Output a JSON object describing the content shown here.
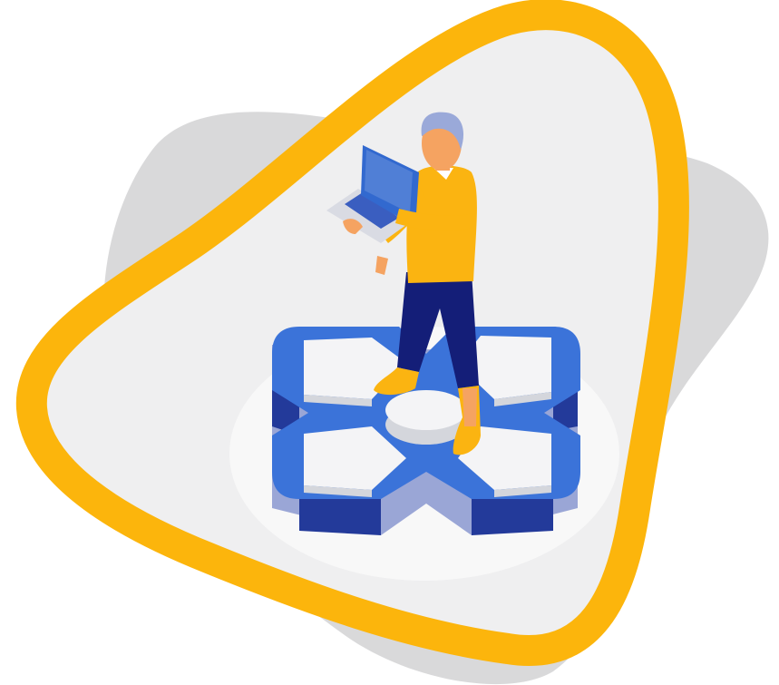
{
  "colors": {
    "background": "#ffffff",
    "gray_blob": "#d9d9da",
    "triangle_fill": "#efeff0",
    "triangle_stroke": "#fcb50c",
    "platform_blue": "#3b73d9",
    "platform_dark": "#233a9a",
    "platform_side": "#9aa6d6",
    "tile_white": "#f4f4f6",
    "tile_shadow": "#d4d6dc",
    "sweater": "#fbb411",
    "pants": "#141e78",
    "skin": "#f5a361",
    "hair": "#9aa9d9",
    "laptop_screen": "#3269cf",
    "laptop_body": "#d9dbe3",
    "keyboard": "#3a5ec0",
    "shoe": "#fbb411"
  },
  "scene": {
    "subject": "person-holding-laptop-standing-on-platform",
    "icons": [
      "person-figure",
      "laptop-icon",
      "cross-platform"
    ]
  }
}
